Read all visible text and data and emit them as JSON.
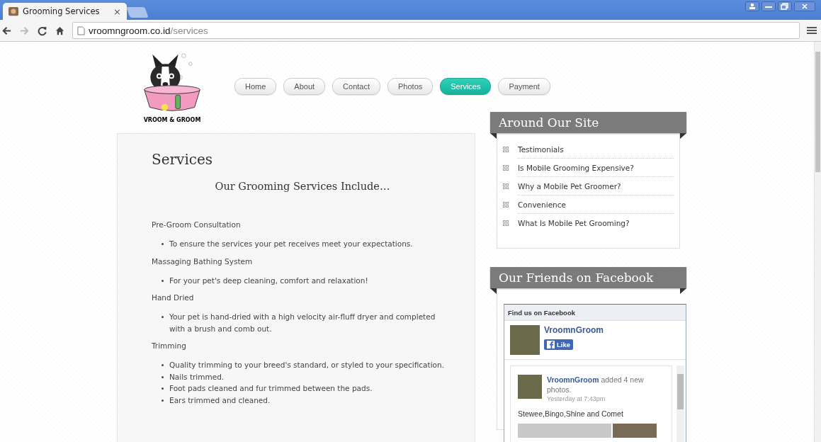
{
  "browser": {
    "tabs": [
      {
        "title": "Grooming Services",
        "close": "×",
        "selected": true
      }
    ],
    "url": {
      "host": "vroomngroom.co.id",
      "path": "/services"
    }
  },
  "logo": {
    "text": "VROOM & GROOM"
  },
  "nav": [
    {
      "label": "Home",
      "selected": false
    },
    {
      "label": "About",
      "selected": false
    },
    {
      "label": "Contact",
      "selected": false
    },
    {
      "label": "Photos",
      "selected": false
    },
    {
      "label": "Services",
      "selected": true
    },
    {
      "label": "Payment",
      "selected": false
    }
  ],
  "main": {
    "title": "Services",
    "subtitle": "Our Grooming Services Include…",
    "sections": [
      {
        "heading": "Pre-Groom Consultation",
        "items": [
          "To ensure the services your pet receives meet your expectations."
        ]
      },
      {
        "heading": "Massaging Bathing System",
        "items": [
          "For your pet's deep cleaning, comfort and relaxation!"
        ]
      },
      {
        "heading": "Hand Dried",
        "items": [
          "Your pet is hand-dried with a high velocity air-fluff dryer and completed with a brush and comb out."
        ]
      },
      {
        "heading": "Trimming",
        "items": [
          "Quality trimming to your breed's standard, or styled to your specification.",
          "Nails trimmed.",
          "Foot pads cleaned and fur trimmed between the pads.",
          "Ears trimmed and cleaned."
        ]
      }
    ]
  },
  "sidebar": {
    "around": {
      "title": "Around Our Site",
      "links": [
        "Testimonials",
        "Is Mobile Grooming Expensive?",
        "Why a Mobile Pet Groomer?",
        "Convenience",
        "What Is Mobile Pet Grooming?"
      ]
    },
    "facebook": {
      "title": "Our Friends on Facebook",
      "header": "Find us on Facebook",
      "page_name": "VroomnGroom",
      "like": "Like",
      "post": {
        "author": "VroomnGroom",
        "action": "added 4 new photos.",
        "time": "Yesterday at 7:43pm",
        "caption": "Stewee,Bingo,Shine and Comet"
      }
    }
  }
}
